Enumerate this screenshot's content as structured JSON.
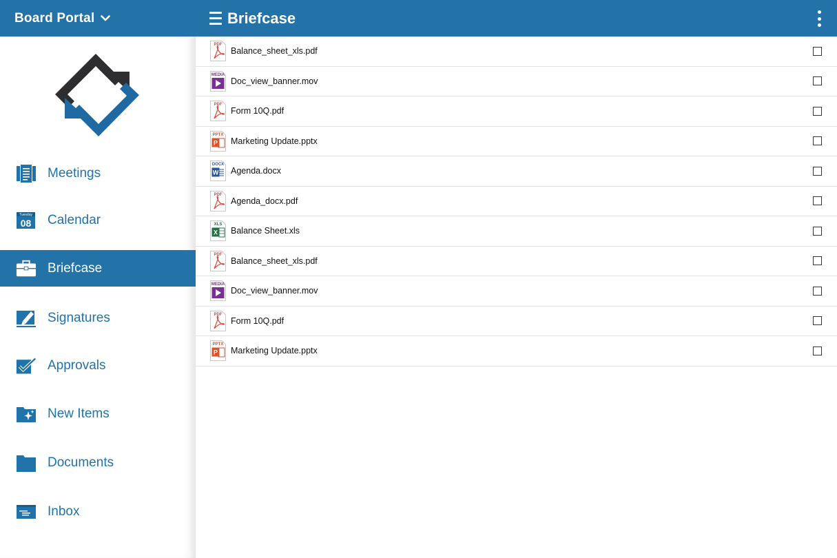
{
  "sidebar": {
    "title": "Board Portal",
    "nav": [
      {
        "label": "Meetings",
        "icon": "meetings-icon"
      },
      {
        "label": "Calendar",
        "icon": "calendar-icon",
        "icon_text_top": "Tuesday",
        "icon_text_day": "08"
      },
      {
        "label": "Briefcase",
        "icon": "briefcase-icon",
        "active": true
      },
      {
        "label": "Signatures",
        "icon": "signature-icon"
      },
      {
        "label": "Approvals",
        "icon": "approvals-icon"
      },
      {
        "label": "New Items",
        "icon": "new-items-icon"
      },
      {
        "label": "Documents",
        "icon": "folder-icon"
      },
      {
        "label": "Inbox",
        "icon": "inbox-icon"
      }
    ]
  },
  "main": {
    "title": "Briefcase",
    "files": [
      {
        "name": "Balance_sheet_xls.pdf",
        "type": "PDF"
      },
      {
        "name": "Doc_view_banner.mov",
        "type": "MEDIA"
      },
      {
        "name": "Form 10Q.pdf",
        "type": "PDF"
      },
      {
        "name": "Marketing Update.pptx",
        "type": "PPTX"
      },
      {
        "name": "Agenda.docx",
        "type": "DOCX"
      },
      {
        "name": "Agenda_docx.pdf",
        "type": "PDF"
      },
      {
        "name": "Balance Sheet.xls",
        "type": "XLS"
      },
      {
        "name": "Balance_sheet_xls.pdf",
        "type": "PDF"
      },
      {
        "name": "Doc_view_banner.mov",
        "type": "MEDIA"
      },
      {
        "name": "Form 10Q.pdf",
        "type": "PDF"
      },
      {
        "name": "Marketing Update.pptx",
        "type": "PPTX"
      }
    ]
  },
  "colors": {
    "brand": "#2473a8",
    "pdf": "#e0453a",
    "media": "#7a2f93",
    "pptx": "#d9532b",
    "docx": "#2b5797",
    "xls": "#207245"
  }
}
